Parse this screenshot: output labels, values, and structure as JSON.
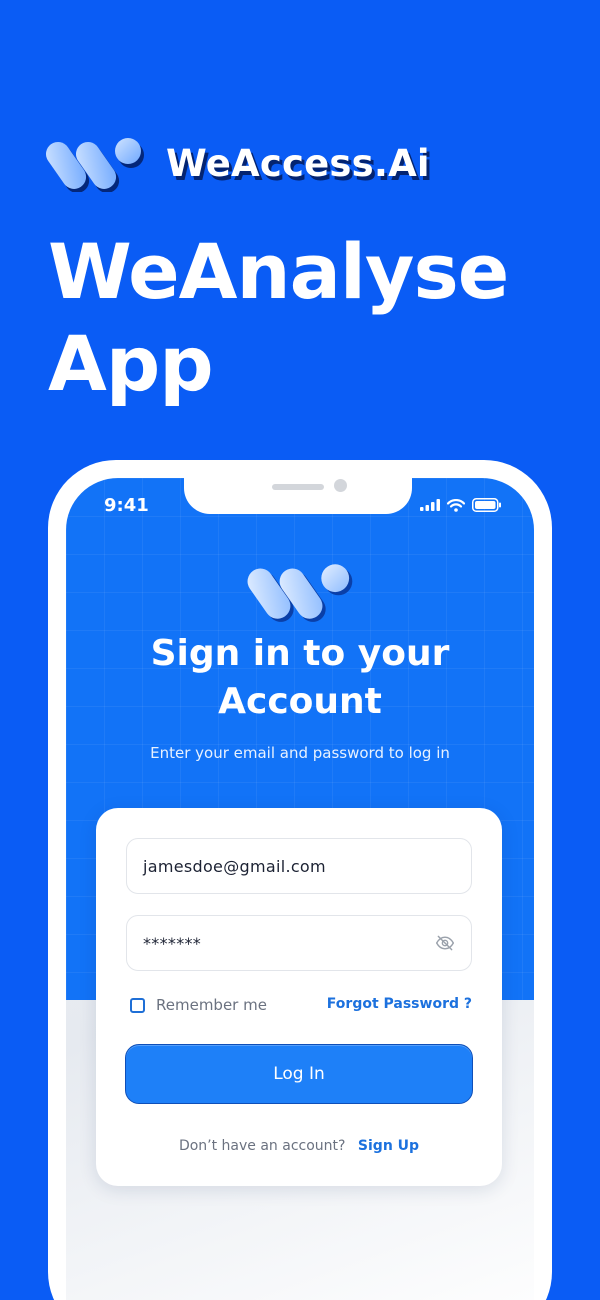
{
  "brand": {
    "name": "WeAccess.Ai",
    "logo_icon": "w-logo-icon"
  },
  "hero": {
    "line1": "WeAnalyse",
    "line2": "App"
  },
  "status_bar": {
    "time": "9:41",
    "icons": [
      "signal-icon",
      "wifi-icon",
      "battery-icon"
    ]
  },
  "signin": {
    "title_line1": "Sign in to your",
    "title_line2": "Account",
    "subtitle": "Enter your email and password to log in"
  },
  "form": {
    "email_value": "jamesdoe@gmail.com",
    "password_value": "*******",
    "remember_label": "Remember me",
    "remember_checked": false,
    "forgot_label": "Forgot Password ?",
    "login_label": "Log In",
    "signup_question": "Don’t have an account?",
    "signup_label": "Sign Up"
  },
  "colors": {
    "background": "#0a5cf5",
    "screen_blue": "#1273f7",
    "accent": "#1e80f8",
    "link": "#1c71de"
  }
}
